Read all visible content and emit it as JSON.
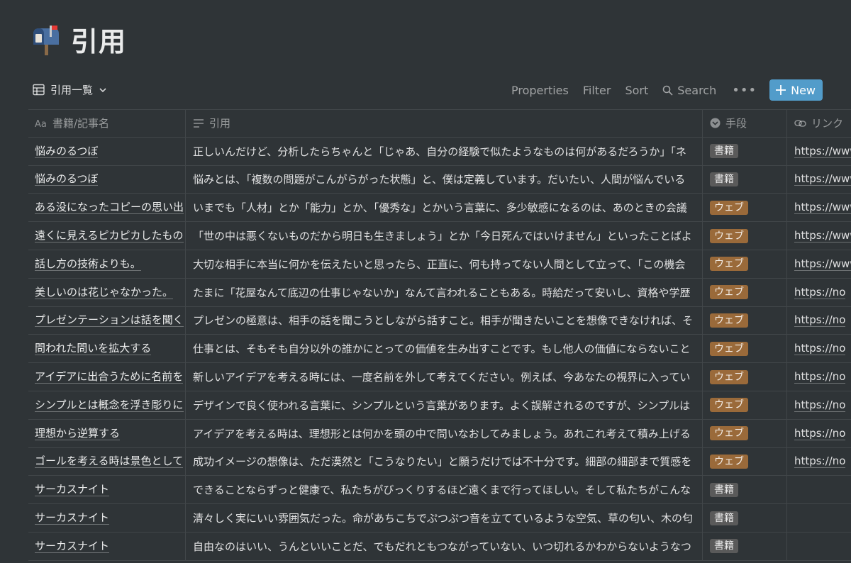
{
  "page": {
    "title": "引用",
    "icon": "mailbox-icon"
  },
  "toolbar": {
    "view_name": "引用一覧",
    "properties": "Properties",
    "filter": "Filter",
    "sort": "Sort",
    "search": "Search",
    "new": "New"
  },
  "colors": {
    "background": "#2f3437",
    "accent": "#529cca",
    "tag_book": "#5a5a5a",
    "tag_web": "#9a6a3a"
  },
  "columns": [
    {
      "label": "書籍/記事名",
      "icon": "text-aa-icon"
    },
    {
      "label": "引用",
      "icon": "text-lines-icon"
    },
    {
      "label": "手段",
      "icon": "select-icon"
    },
    {
      "label": "リンク",
      "icon": "link-icon"
    }
  ],
  "rows": [
    {
      "title": "悩みのるつぼ",
      "quote": "正しいんだけど、分析したらちゃんと「じゃあ、自分の経験で似たようなものは何があるだろうか」「ネ",
      "tag": "書籍",
      "tag_type": "book",
      "link": "https://www"
    },
    {
      "title": "悩みのるつぼ",
      "quote": "悩みとは、「複数の問題がこんがらがった状態」と、僕は定義しています。だいたい、人間が悩んでいる",
      "tag": "書籍",
      "tag_type": "book",
      "link": "https://www"
    },
    {
      "title": "ある没になったコピーの思い出",
      "quote": "いまでも「人材」とか「能力」とか、「優秀な」とかいう言葉に、多少敏感になるのは、あのときの会議",
      "tag": "ウェブ",
      "tag_type": "web",
      "link": "https://www"
    },
    {
      "title": "遠くに見えるピカピカしたもの",
      "quote": "「世の中は悪くないものだから明日も生きましょう」とか「今日死んではいけません」といったことばよ",
      "tag": "ウェブ",
      "tag_type": "web",
      "link": "https://www"
    },
    {
      "title": "話し方の技術よりも。",
      "quote": "大切な相手に本当に何かを伝えたいと思ったら、正直に、何も持ってない人間として立って、「この機会",
      "tag": "ウェブ",
      "tag_type": "web",
      "link": "https://www"
    },
    {
      "title": "美しいのは花じゃなかった。",
      "quote": "たまに「花屋なんて底辺の仕事じゃないか」なんて言われることもある。時給だって安いし、資格や学歴",
      "tag": "ウェブ",
      "tag_type": "web",
      "link": "https://no"
    },
    {
      "title": "プレゼンテーションは話を聞く",
      "quote": "プレゼンの極意は、相手の話を聞こうとしながら話すこと。相手が聞きたいことを想像できなければ、そ",
      "tag": "ウェブ",
      "tag_type": "web",
      "link": "https://no"
    },
    {
      "title": "問われた問いを拡大する",
      "quote": "仕事とは、そもそも自分以外の誰かにとっての価値を生み出すことです。もし他人の価値にならないこと",
      "tag": "ウェブ",
      "tag_type": "web",
      "link": "https://no"
    },
    {
      "title": "アイデアに出合うために名前を",
      "quote": "新しいアイデアを考える時には、一度名前を外して考えてください。例えば、今あなたの視界に入ってい",
      "tag": "ウェブ",
      "tag_type": "web",
      "link": "https://no"
    },
    {
      "title": "シンプルとは概念を浮き彫りに",
      "quote": "デザインで良く使われる言葉に、シンプルという言葉があります。よく誤解されるのですが、シンプルは",
      "tag": "ウェブ",
      "tag_type": "web",
      "link": "https://no"
    },
    {
      "title": "理想から逆算する",
      "quote": "アイデアを考える時は、理想形とは何かを頭の中で問いなおしてみましょう。あれこれ考えて積み上げる",
      "tag": "ウェブ",
      "tag_type": "web",
      "link": "https://no"
    },
    {
      "title": "ゴールを考える時は景色として",
      "quote": "成功イメージの想像は、ただ漠然と「こうなりたい」と願うだけでは不十分です。細部の細部まで質感を",
      "tag": "ウェブ",
      "tag_type": "web",
      "link": "https://no"
    },
    {
      "title": "サーカスナイト",
      "quote": "できることならずっと健康で、私たちがびっくりするほど遠くまで行ってほしい。そして私たちがこんな",
      "tag": "書籍",
      "tag_type": "book",
      "link": ""
    },
    {
      "title": "サーカスナイト",
      "quote": "清々しく実にいい雰囲気だった。命があちこちでぷつぷつ音を立てているような空気、草の匂い、木の匂",
      "tag": "書籍",
      "tag_type": "book",
      "link": ""
    },
    {
      "title": "サーカスナイト",
      "quote": "自由なのはいい、うんといいことだ、でもだれともつながっていない、いつ切れるかわからないようなつ",
      "tag": "書籍",
      "tag_type": "book",
      "link": ""
    }
  ]
}
